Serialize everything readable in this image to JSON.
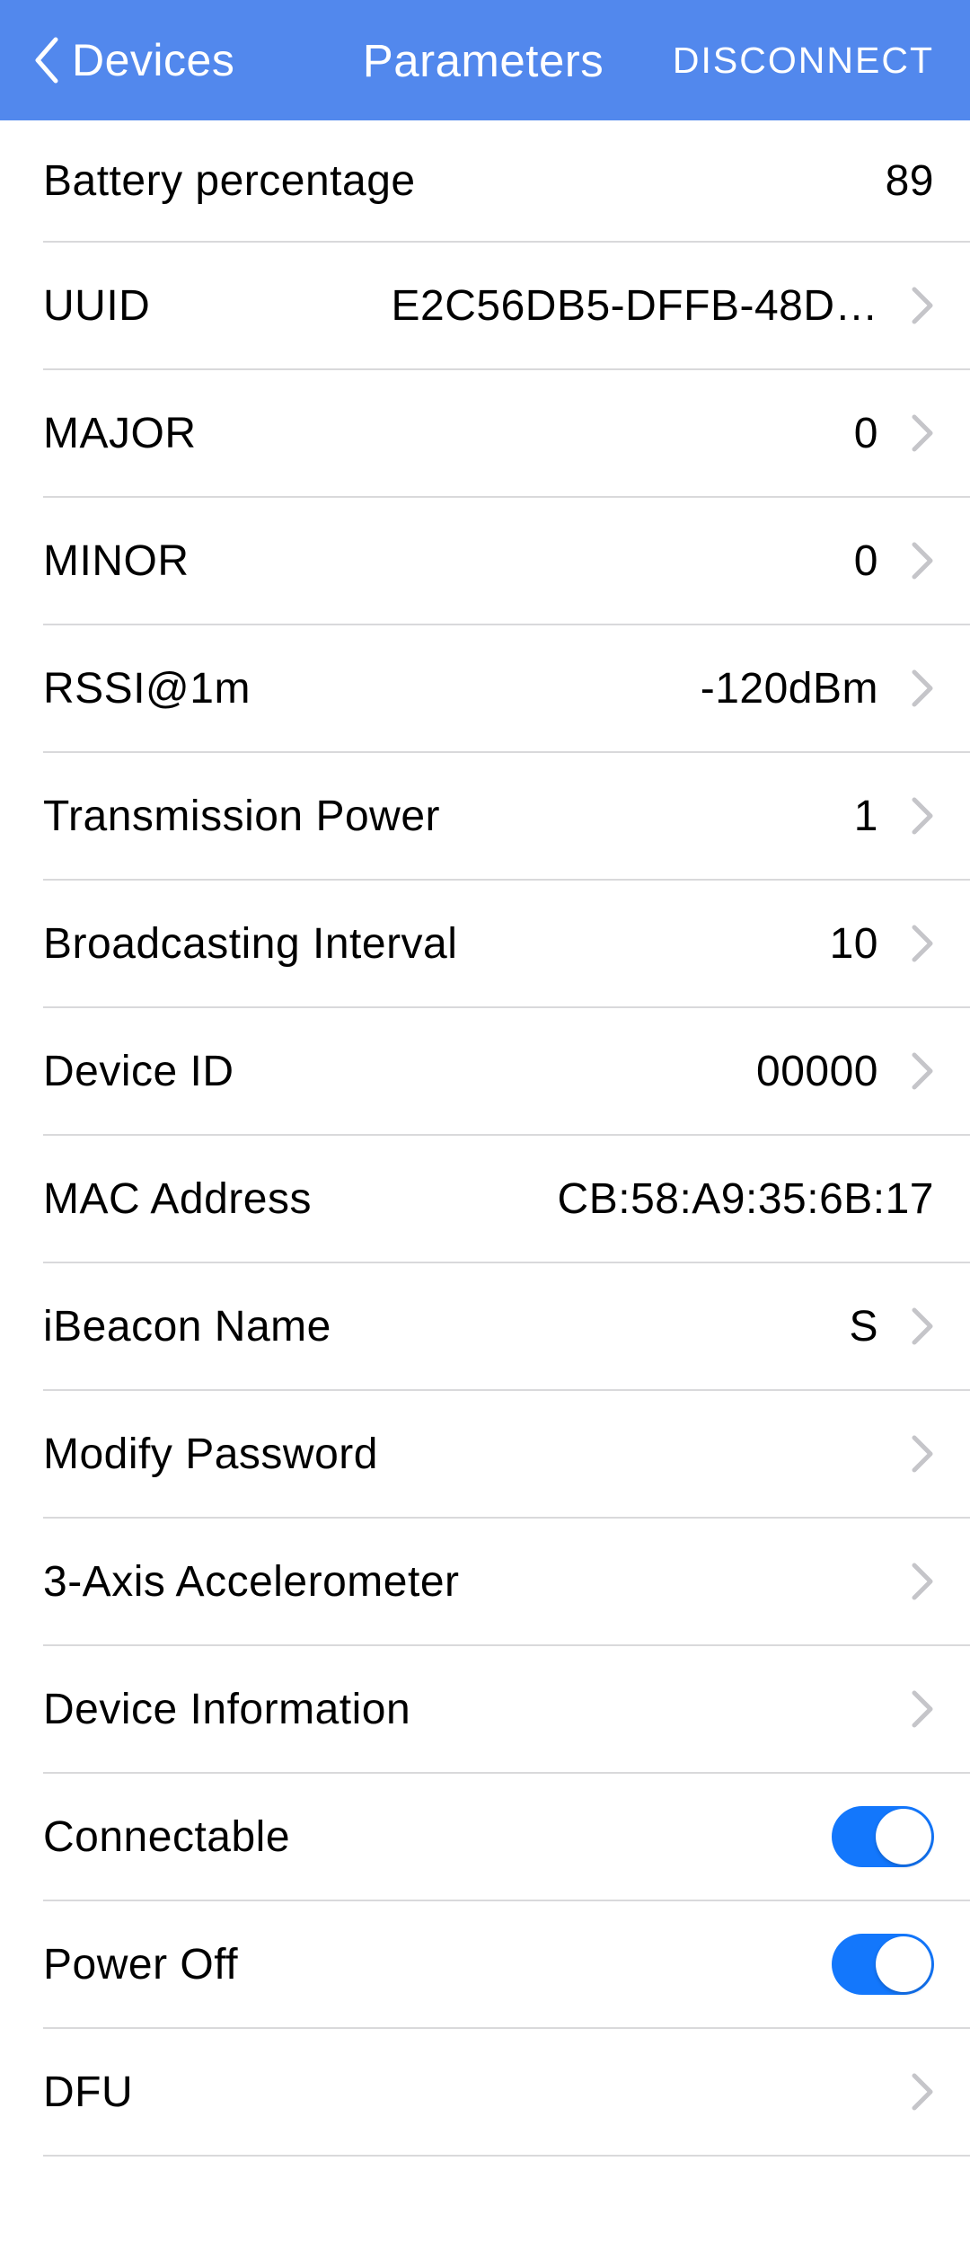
{
  "header": {
    "back_label": "Devices",
    "title": "Parameters",
    "action": "DISCONNECT"
  },
  "rows": {
    "battery": {
      "label": "Battery percentage",
      "value": "89"
    },
    "uuid": {
      "label": "UUID",
      "value": "E2C56DB5-DFFB-48D…"
    },
    "major": {
      "label": "MAJOR",
      "value": "0"
    },
    "minor": {
      "label": "MINOR",
      "value": "0"
    },
    "rssi": {
      "label": "RSSI@1m",
      "value": "-120dBm"
    },
    "txpower": {
      "label": "Transmission Power",
      "value": "1"
    },
    "interval": {
      "label": "Broadcasting Interval",
      "value": "10"
    },
    "deviceid": {
      "label": "Device ID",
      "value": "00000"
    },
    "mac": {
      "label": "MAC Address",
      "value": "CB:58:A9:35:6B:17"
    },
    "name": {
      "label": "iBeacon Name",
      "value": "S"
    },
    "password": {
      "label": "Modify Password",
      "value": ""
    },
    "accel": {
      "label": "3-Axis Accelerometer",
      "value": ""
    },
    "deviceinfo": {
      "label": "Device Information",
      "value": ""
    },
    "connectable": {
      "label": "Connectable",
      "on": true
    },
    "poweroff": {
      "label": "Power Off",
      "on": true
    },
    "dfu": {
      "label": "DFU",
      "value": ""
    }
  }
}
